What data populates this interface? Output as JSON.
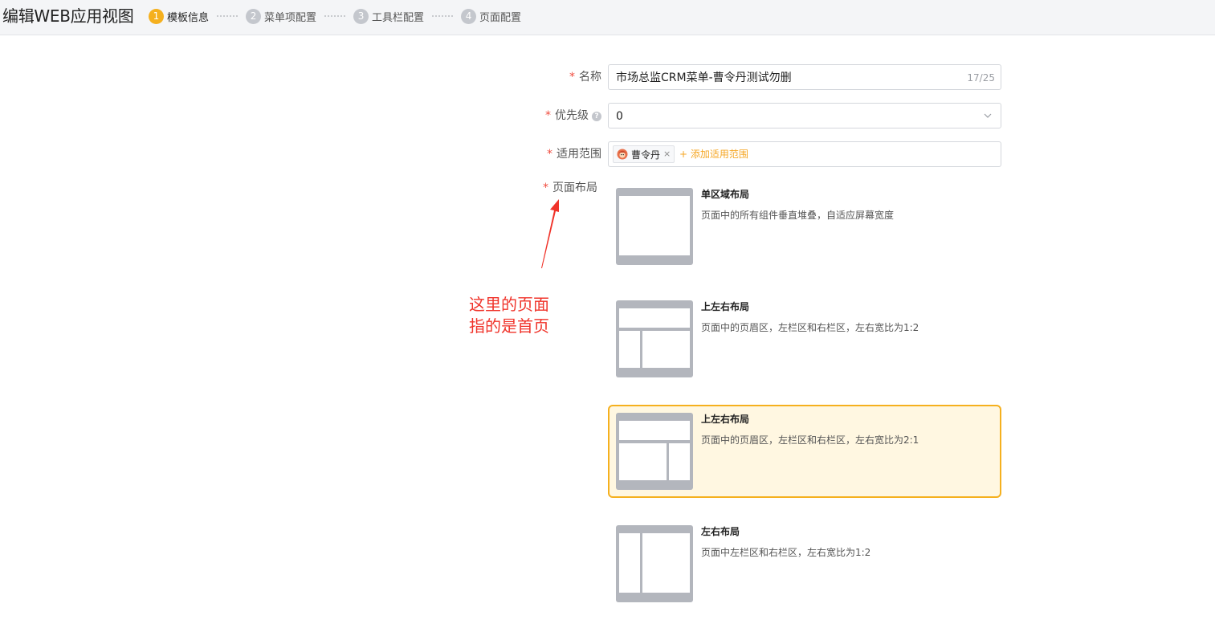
{
  "header": {
    "title": "编辑WEB应用视图",
    "steps": [
      {
        "num": "1",
        "label": "模板信息"
      },
      {
        "num": "2",
        "label": "菜单项配置"
      },
      {
        "num": "3",
        "label": "工具栏配置"
      },
      {
        "num": "4",
        "label": "页面配置"
      }
    ]
  },
  "form": {
    "required_mark": "*",
    "name": {
      "label": "名称",
      "value": "市场总监CRM菜单-曹令丹测试勿删",
      "counter": "17/25"
    },
    "priority": {
      "label": "优先级",
      "help": "?",
      "value": "0"
    },
    "scope": {
      "label": "适用范围",
      "tag": "曹令丹",
      "tag_close": "×",
      "add_label": "+ 添加适用范围"
    },
    "layout": {
      "label": "页面布局",
      "options": [
        {
          "title": "单区域布局",
          "desc": "页面中的所有组件垂直堆叠，自适应屏幕宽度",
          "selected": false
        },
        {
          "title": "上左右布局",
          "desc": "页面中的页眉区，左栏区和右栏区，左右宽比为1:2",
          "selected": false
        },
        {
          "title": "上左右布局",
          "desc": "页面中的页眉区，左栏区和右栏区，左右宽比为2:1",
          "selected": true
        },
        {
          "title": "左右布局",
          "desc": "页面中左栏区和右栏区，左右宽比为1:2",
          "selected": false
        }
      ]
    }
  },
  "annotation": {
    "line1": "这里的页面",
    "line2": "指的是首页",
    "color": "#f0332a"
  },
  "colors": {
    "accent": "#f5b01e",
    "selected_bg": "#fff7e1",
    "thumb_gray": "#b3b6bd"
  },
  "icons": {
    "help": "question-circle-icon",
    "chevron": "chevron-down-icon",
    "avatar": "user-avatar-icon",
    "close": "close-icon"
  }
}
